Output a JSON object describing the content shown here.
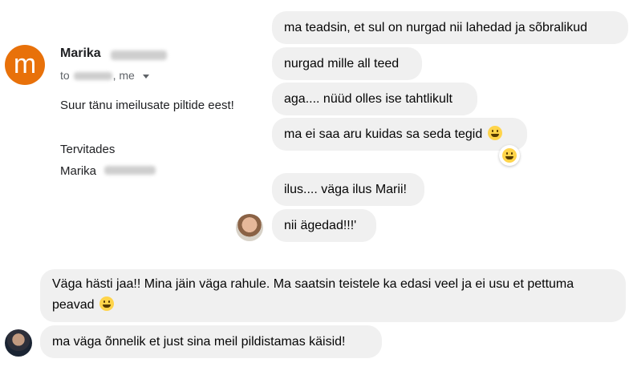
{
  "email": {
    "avatar_letter": "m",
    "sender_first_name": "Marika",
    "to_prefix": "to",
    "to_suffix": ", me",
    "body_line": "Suur tänu imeilusate piltide eest!",
    "closing": "Tervitades",
    "signature_first_name": "Marika"
  },
  "chat": {
    "sent_messages": [
      "ma teadsin, et sul on nurgad nii lahedad ja sõbralikud",
      "nurgad mille all teed",
      "aga.... nüüd olles ise tahtlikult",
      "ma ei saa aru kuidas sa seda tegid",
      "ilus.... väga ilus Marii!",
      "nii ägedad!!!'"
    ],
    "received_messages": [
      "Väga hästi jaa!! Mina jäin väga rahule. Ma saatsin teistele ka edasi veel ja ei usu et pettuma peavad",
      "ma väga õnnelik et just sina meil pildistamas käisid!"
    ],
    "reaction_icon": "laughing-emoji-icon",
    "inline_emoji_icon": "grinning-emoji-icon"
  },
  "colors": {
    "bubble": "#f0f0f0",
    "email_avatar": "#e8710a",
    "text": "#050505"
  }
}
